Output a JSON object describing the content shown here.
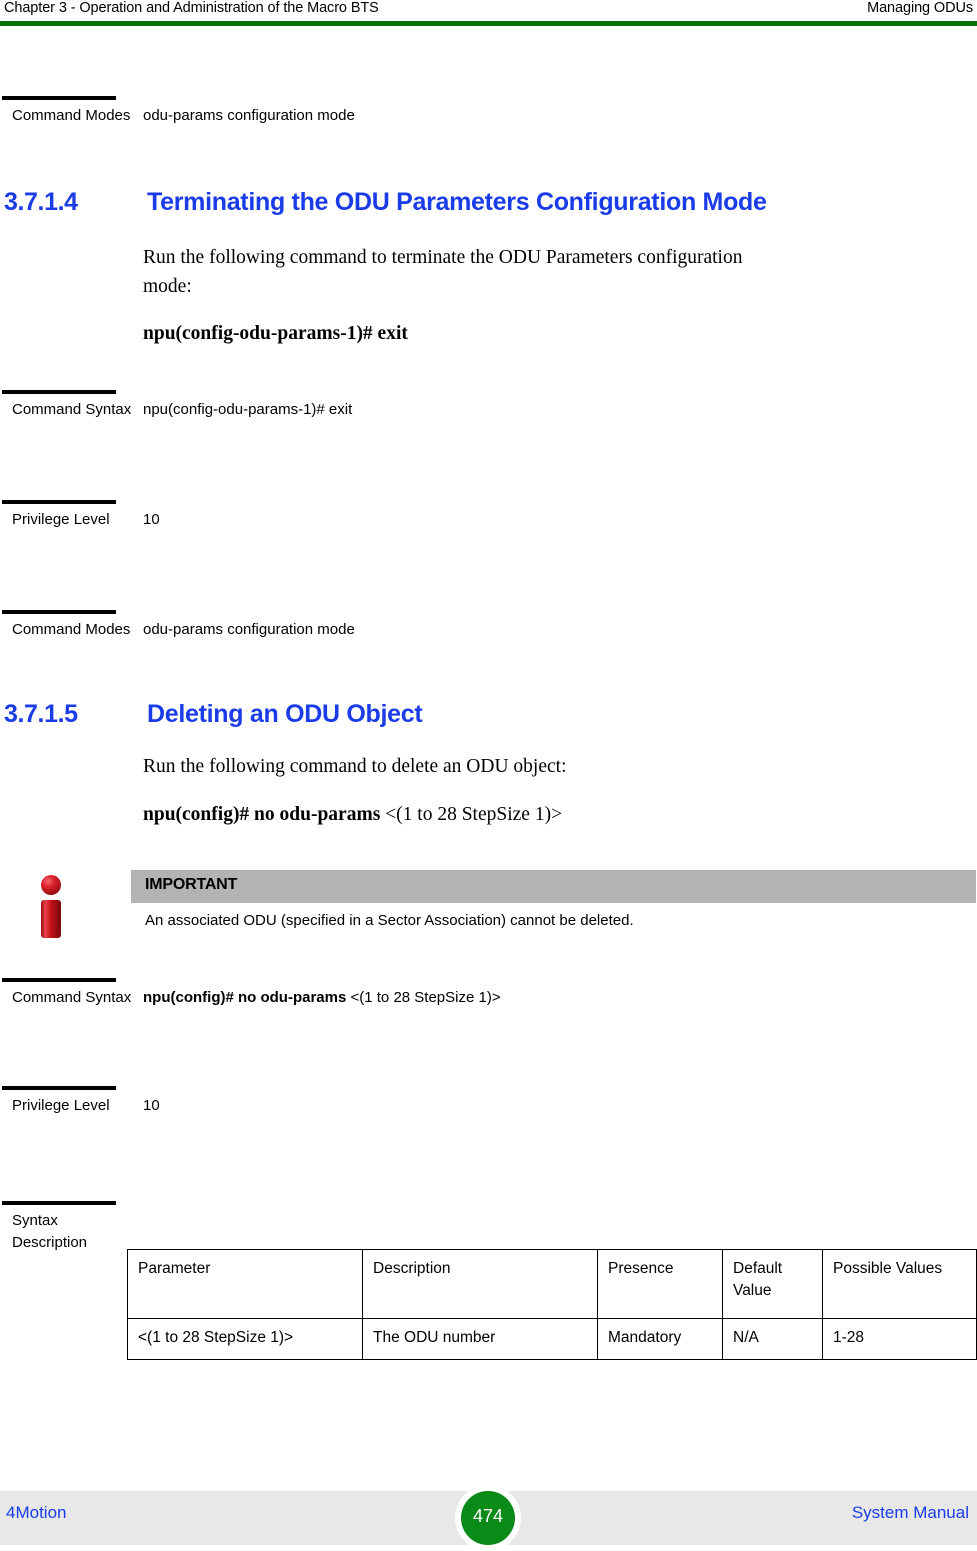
{
  "header": {
    "left": "Chapter 3 - Operation and Administration of the Macro BTS",
    "right": "Managing ODUs",
    "rule_color": "#067006"
  },
  "blocks": {
    "modes_top": {
      "label": "Command Modes",
      "value": "odu-params configuration mode"
    },
    "syntax_1": {
      "label": "Command Syntax",
      "value": "npu(config-odu-params-1)# exit"
    },
    "privilege_1": {
      "label": "Privilege Level",
      "value": "10"
    },
    "modes_1": {
      "label": "Command Modes",
      "value": "odu-params configuration mode"
    },
    "syntax_2": {
      "label": "Command Syntax",
      "value_bold": "npu(config)# no odu-params",
      "value_arg": " <(1 to 28 StepSize 1)>"
    },
    "privilege_2": {
      "label": "Privilege Level",
      "value": "10"
    },
    "syntax_desc": {
      "label": "Syntax Description"
    }
  },
  "section_3714": {
    "number": "3.7.1.4",
    "title": "Terminating the ODU Parameters Configuration Mode",
    "intro_line1": "Run the following command to terminate the ODU Parameters configuration",
    "intro_line2": "mode:",
    "command": "npu(config-odu-params-1)# exit"
  },
  "section_3715": {
    "number": "3.7.1.5",
    "title": "Deleting an ODU Object",
    "intro": "Run the following command to delete an ODU object:",
    "command_bold": "npu(config)# no odu-params",
    "command_arg": " <(1 to 28 StepSize 1)>"
  },
  "callout": {
    "icon": "info-icon",
    "title": "IMPORTANT",
    "text": "An associated ODU (specified in a Sector Association) cannot be deleted.",
    "band_color": "#b3b3b3",
    "icon_color": "#c2121a"
  },
  "param_table": {
    "columns": [
      "Parameter",
      "Description",
      "Presence",
      "Default Value",
      "Possible Values"
    ],
    "rows": [
      [
        "<(1 to 28 StepSize 1)>",
        "The ODU number",
        "Mandatory",
        "N/A",
        "1-28"
      ]
    ]
  },
  "footer": {
    "left": "4Motion",
    "page": "474",
    "right": "System Manual",
    "link_color": "#1a3ce8",
    "badge_color": "#0a8a16",
    "band_color": "#e8e8e8"
  }
}
